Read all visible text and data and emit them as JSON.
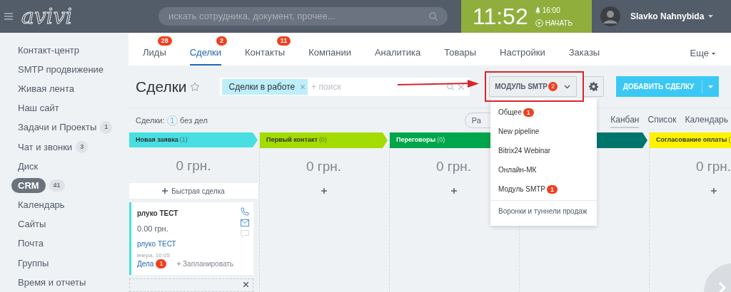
{
  "topbar": {
    "logo": "avivi",
    "search_placeholder": "искать сотрудника, документ, прочее...",
    "clock": "11:52",
    "alarm": "16:00",
    "start": "НАЧАТЬ",
    "user": "Slavko Nahnybida"
  },
  "sidebar": {
    "items": [
      {
        "label": "Контакт-центр",
        "selected": false
      },
      {
        "label": "SMTP продвижение",
        "selected": false
      },
      {
        "label": "Живая лента",
        "selected": false
      },
      {
        "label": "Наш сайт",
        "selected": false
      },
      {
        "label": "Задачи и Проекты",
        "badge": "1",
        "selected": false
      },
      {
        "label": "Чат и звонки",
        "badge": "3",
        "selected": false
      },
      {
        "label": "Диск",
        "selected": false
      },
      {
        "label": "CRM",
        "badge": "41",
        "selected": true
      },
      {
        "label": "Календарь",
        "selected": false
      },
      {
        "label": "Сайты",
        "selected": false
      },
      {
        "label": "Почта",
        "selected": false
      },
      {
        "label": "Группы",
        "selected": false
      },
      {
        "label": "Время и отчеты",
        "selected": false
      }
    ]
  },
  "tabs": [
    {
      "label": "Лиды",
      "badge": "28",
      "selected": false
    },
    {
      "label": "Сделки",
      "badge": "2",
      "selected": true
    },
    {
      "label": "Контакты",
      "badge": "11",
      "selected": false
    },
    {
      "label": "Компании",
      "selected": false
    },
    {
      "label": "Аналитика",
      "selected": false
    },
    {
      "label": "Товары",
      "selected": false
    },
    {
      "label": "Настройки",
      "selected": false
    },
    {
      "label": "Заказы",
      "selected": false
    }
  ],
  "more_tab": "Еще",
  "page_title": "Сделки",
  "filter": {
    "chip": "Сделки в работе",
    "placeholder": "+ поиск"
  },
  "pipeline_button": {
    "label": "МОДУЛЬ SMTP",
    "badge": "2"
  },
  "add_button": "ДОБАВИТЬ СДЕЛКУ",
  "summary": {
    "label": "Сделки:",
    "count": "1",
    "suffix": "без дел"
  },
  "partial_button": "Ра",
  "views": [
    {
      "label": "Канбан",
      "selected": true
    },
    {
      "label": "Список",
      "selected": false
    },
    {
      "label": "Календарь",
      "selected": false
    }
  ],
  "columns": [
    {
      "title": "Новая заявка",
      "count": "(1)",
      "color": "#47dfe2",
      "amount": "0 грн.",
      "quick_add": "Быстрая сделка",
      "cards": [
        {
          "title": "рлуко ТЕСТ",
          "amount": "0.00 грн.",
          "contact": "рлуко ТЕСТ",
          "date": "вчера, 10:05",
          "tasks": "Дела",
          "tasks_badge": "1",
          "plan": "+ Запланировать"
        }
      ]
    },
    {
      "title": "Первый контакт",
      "count": "(0)",
      "color": "#a3dc00",
      "amount": "0 грн."
    },
    {
      "title": "Переговоры",
      "count": "(0)",
      "color": "#00a64c",
      "amount": "0 грн."
    },
    {
      "color": "#00756d"
    },
    {
      "title": "Согласование оплаты",
      "count": "(",
      "color": "#fff200",
      "amount": "0 грн."
    }
  ],
  "dropdown": [
    {
      "label": "Общее",
      "badge": "1",
      "kind": "pipeline"
    },
    {
      "label": "New pipeline",
      "kind": "pipeline"
    },
    {
      "label": "Bitrix24 Webinar",
      "kind": "pipeline"
    },
    {
      "label": "Онлайн-МК",
      "kind": "pipeline"
    },
    {
      "label": "Модуль SMTP",
      "badge": "1",
      "kind": "pipeline"
    },
    {
      "label": "Воронки и туннели продаж",
      "kind": "link"
    }
  ]
}
